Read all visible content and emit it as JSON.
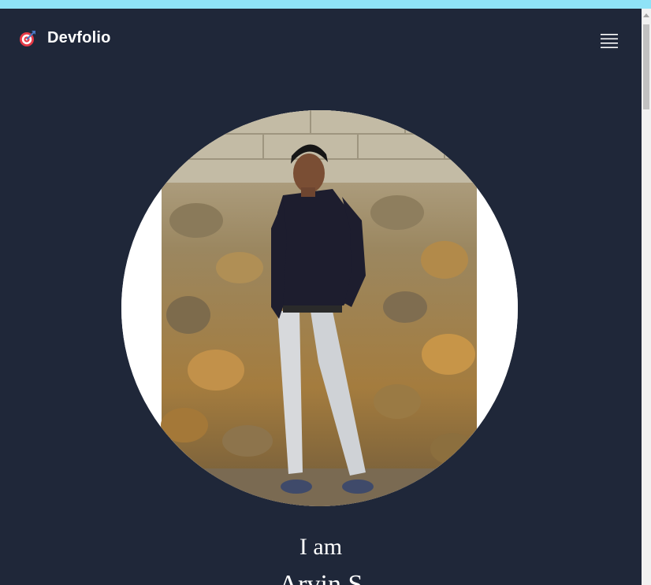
{
  "navbar": {
    "brand_name": "Devfolio",
    "brand_icon": "target-icon",
    "menu_icon": "hamburger-menu-icon"
  },
  "hero": {
    "photo_description_icon": "profile-photo",
    "greeting": "I am",
    "name": "Arvin S"
  },
  "colors": {
    "background": "#1f2739",
    "top_bar": "#8fe3f7",
    "text": "#ffffff"
  }
}
